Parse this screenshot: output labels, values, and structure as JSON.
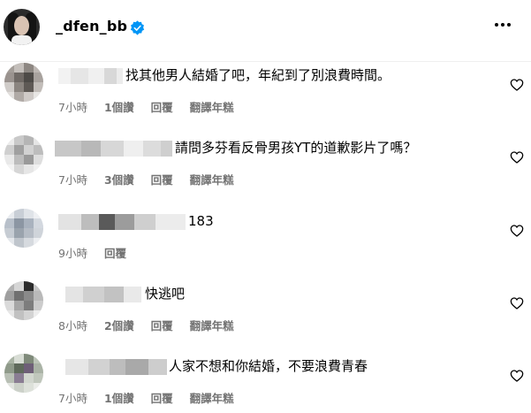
{
  "post": {
    "username": "_dfen_bb",
    "verified": true,
    "more_icon": "more-horizontal-icon"
  },
  "comments": [
    {
      "text": "找其他男人結婚了吧，年紀到了別浪費時間。",
      "time": "7小時",
      "likes": "1個讚",
      "reply": "回覆",
      "translate": "翻譯年糕"
    },
    {
      "text": "請問多芬看反骨男孩YT的道歉影片了嗎？",
      "time": "7小時",
      "likes": "3個讚",
      "reply": "回覆",
      "translate": "翻譯年糕"
    },
    {
      "text": "183",
      "time": "9小時",
      "reply": "回覆"
    },
    {
      "text": "快逃吧",
      "time": "8小時",
      "likes": "2個讚",
      "reply": "回覆",
      "translate": "翻譯年糕"
    },
    {
      "text": "人家不想和你結婚，不要浪費青春",
      "time": "7小時",
      "likes": "1個讚",
      "reply": "回覆",
      "translate": "翻譯年糕"
    }
  ],
  "colors": {
    "meta_text": "#737373",
    "verified_blue": "#0095f6",
    "divider": "#efefef"
  }
}
